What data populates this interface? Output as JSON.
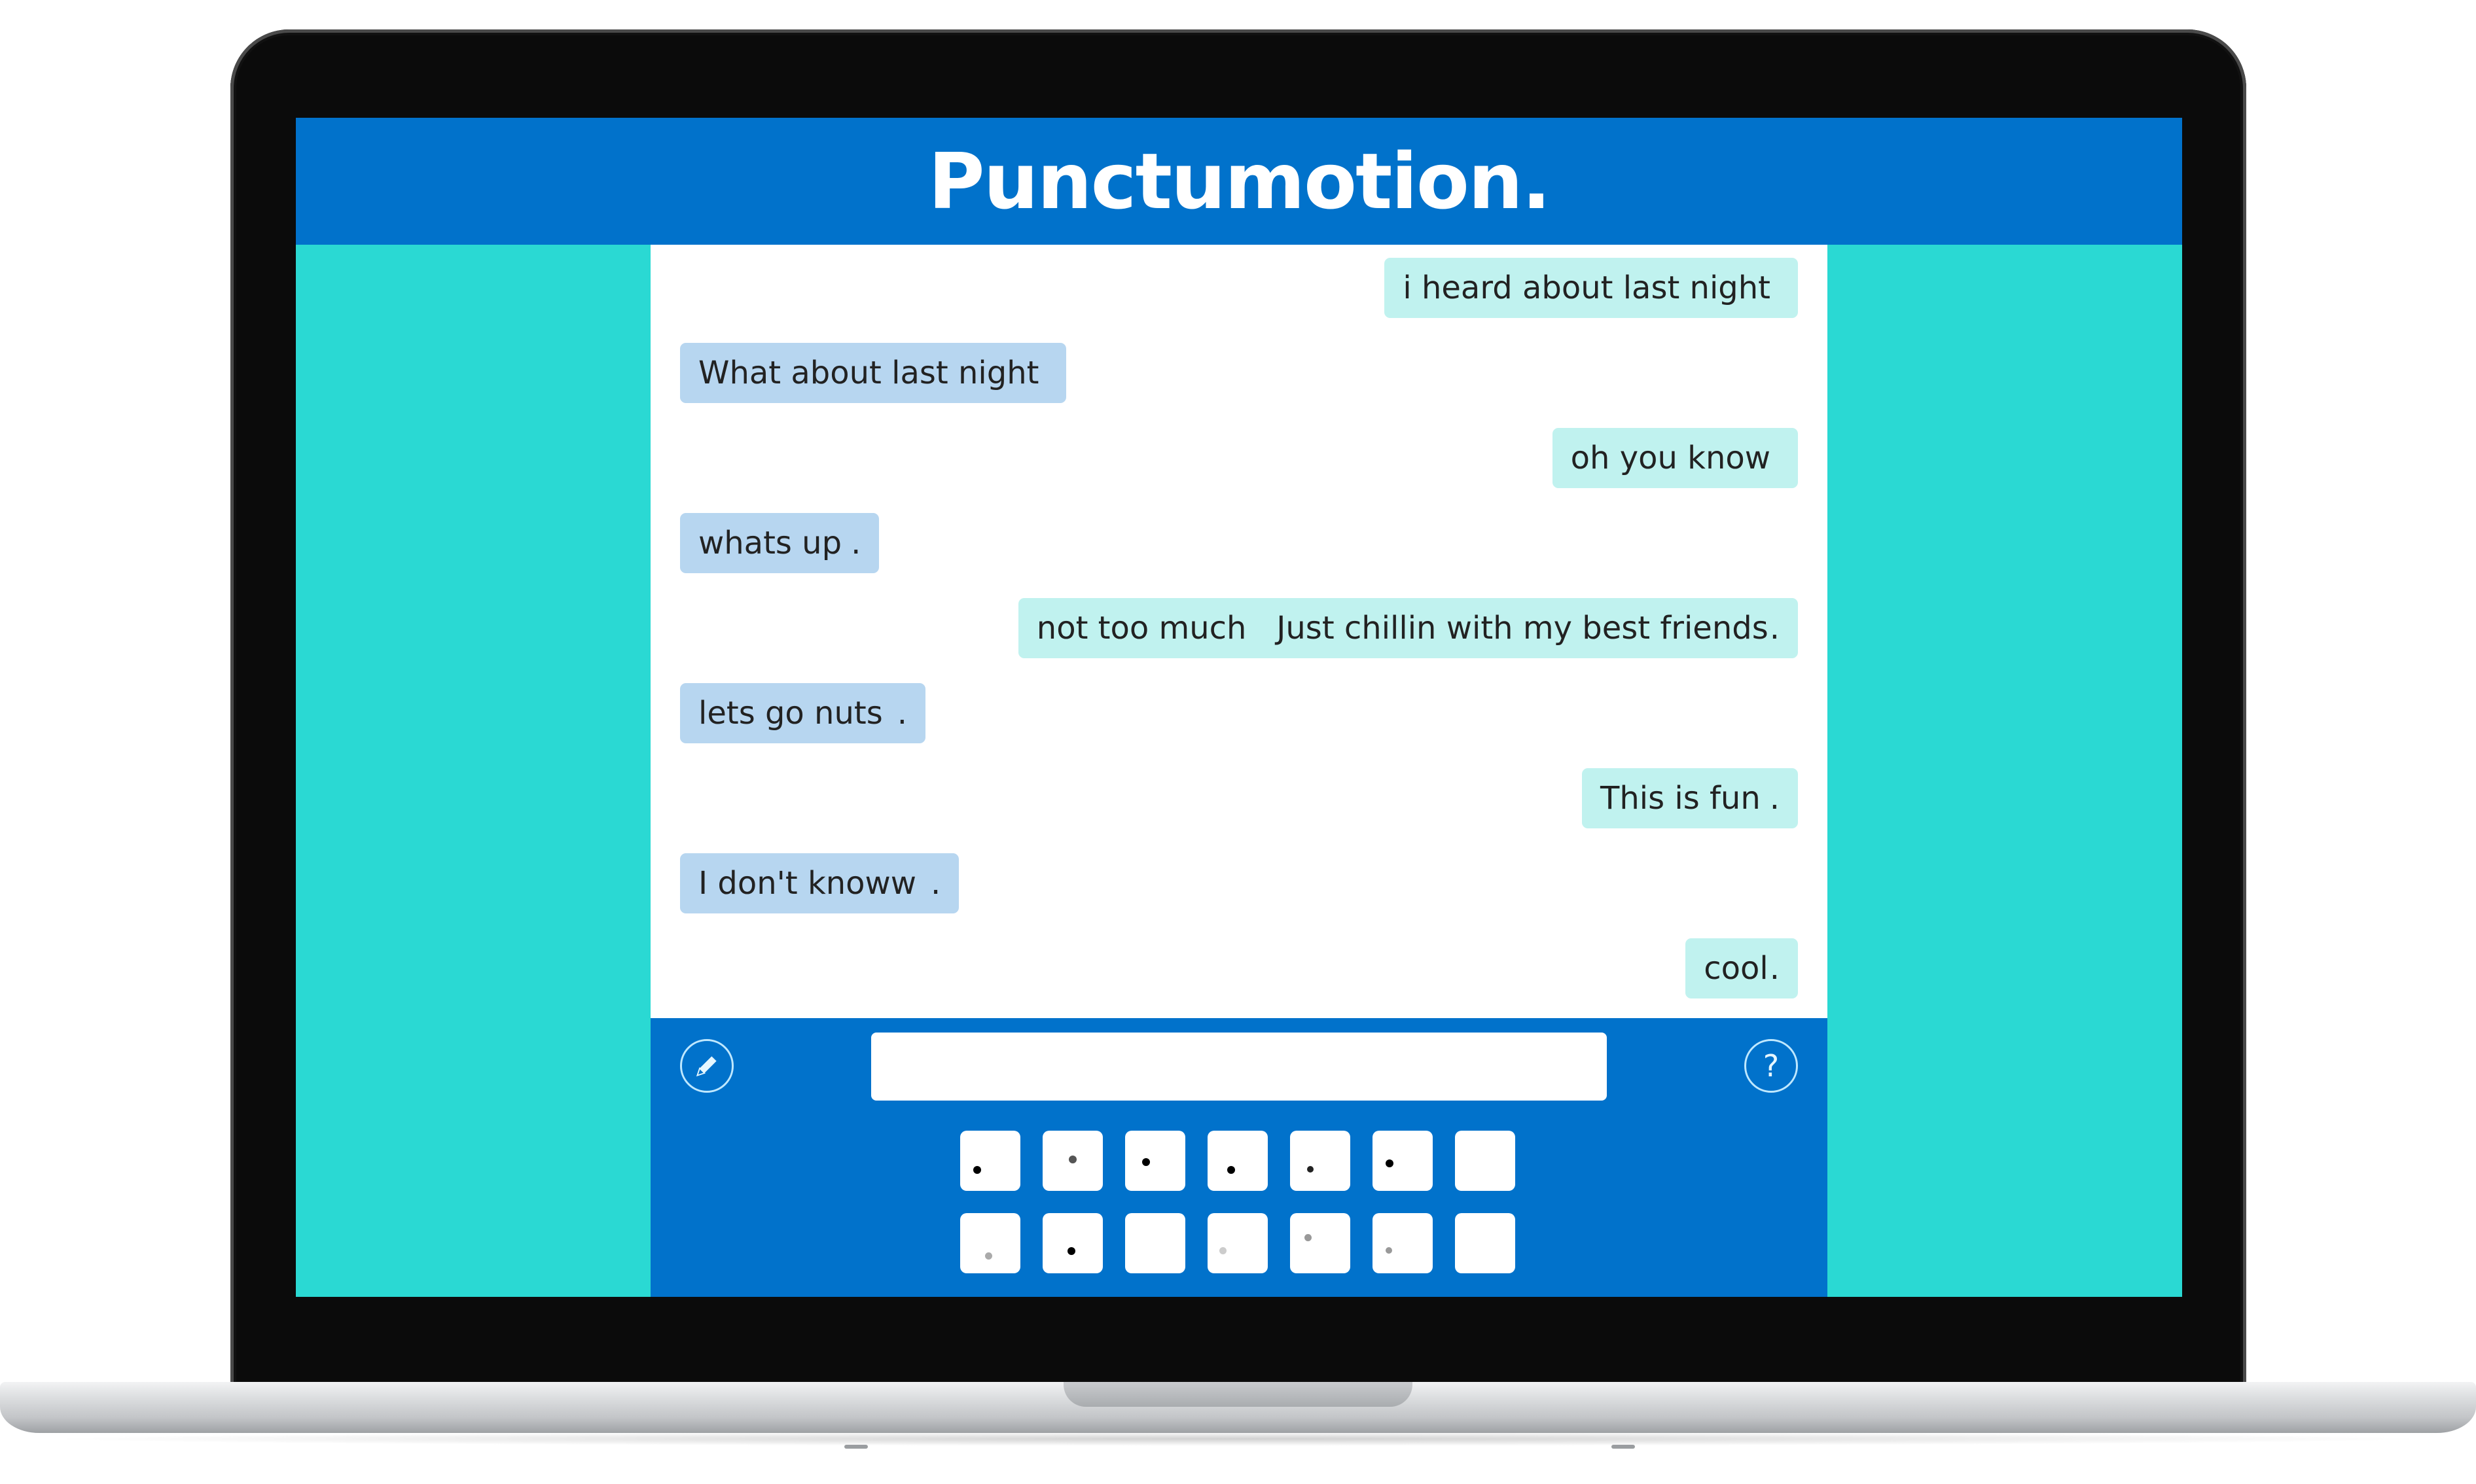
{
  "app": {
    "title": "Punctumotion."
  },
  "messages": [
    {
      "side": "right",
      "text": "i heard about last night",
      "punct": ""
    },
    {
      "side": "left",
      "text": "What about last night",
      "punct": ""
    },
    {
      "side": "right",
      "text": "oh you know",
      "punct": ""
    },
    {
      "side": "left",
      "text": "whats up",
      "punct": "."
    },
    {
      "side": "right",
      "text": "not too much   Just chillin with my best friends",
      "punct": "."
    },
    {
      "side": "left",
      "text": "lets go nuts",
      "punct": "."
    },
    {
      "side": "right",
      "text": "This is fun",
      "punct": "."
    },
    {
      "side": "left",
      "text": "I don't knoww",
      "punct": "."
    },
    {
      "side": "right",
      "text": "cool",
      "punct": "."
    }
  ],
  "composer": {
    "input_value": "",
    "edit_icon": "pencil-icon",
    "help_icon": "question-icon",
    "help_glyph": "?"
  },
  "punctuation_keys": {
    "row1": [
      "dot-low-left",
      "dot-high-gray",
      "dot-mid",
      "dot-low",
      "dot-low-small",
      "dot-mid-left",
      "blank"
    ],
    "row2": [
      "dot-low-gray",
      "dot-low-bold",
      "blank",
      "dot-low-faint",
      "dot-high-gray",
      "dot-low-gray-small",
      "blank"
    ]
  },
  "colors": {
    "header": "#0172cb",
    "side_panels": "#2ad9d3",
    "bubble_right": "#c0f2ef",
    "bubble_left": "#b7d6f0",
    "composer": "#0172cb"
  }
}
